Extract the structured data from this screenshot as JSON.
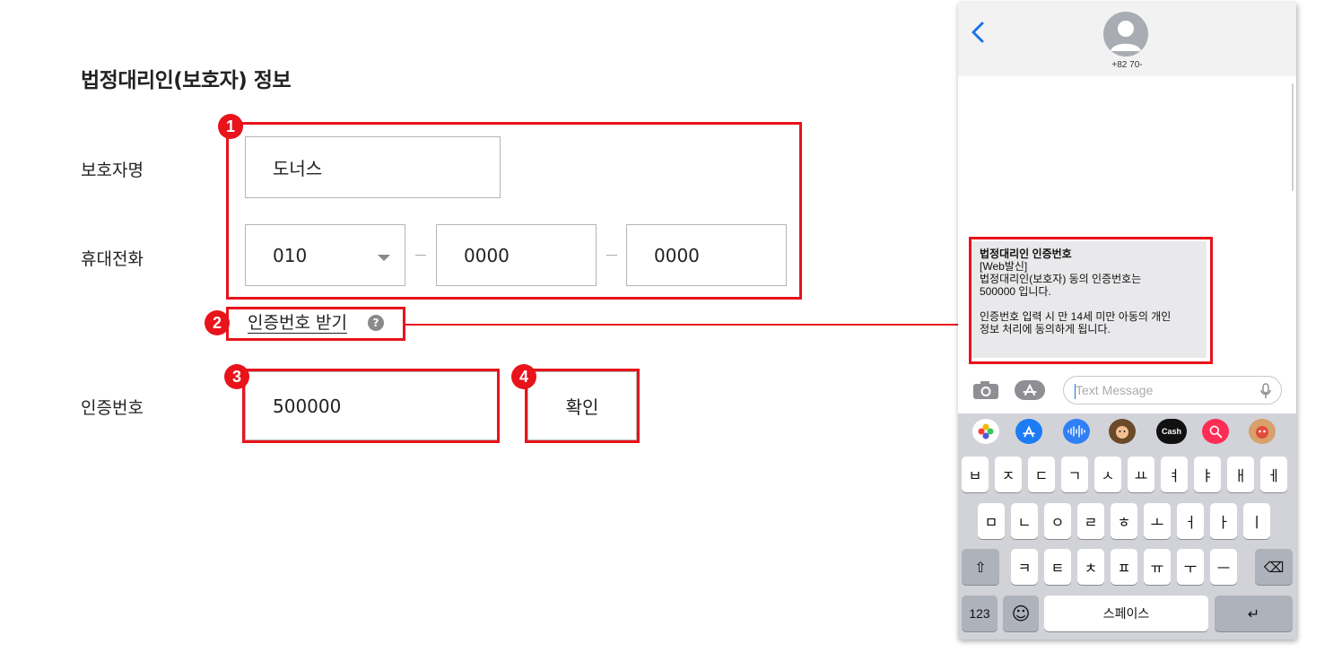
{
  "form": {
    "section_title": "법정대리인(보호자) 정보",
    "guardian_name_label": "보호자명",
    "guardian_name_value": "도너스",
    "phone_label": "휴대전화",
    "phone_prefix_value": "010",
    "phone_middle_value": "0000",
    "phone_last_value": "0000",
    "get_code_link": "인증번호 받기",
    "help_icon_text": "?",
    "code_label": "인증번호",
    "code_value": "500000",
    "confirm_button": "확인"
  },
  "badges": [
    "1",
    "2",
    "3",
    "4"
  ],
  "annotation_color": "#e8131b",
  "phone": {
    "contact_number": "+82 70-",
    "sms_lines": [
      "법정대리인 인증번호",
      "[Web발신]",
      "법정대리인(보호자) 동의 인증번호는",
      "500000 입니다.",
      "",
      "인증번호 입력 시 만 14세 미만 아동의 개인",
      "정보 처리에 동의하게 됩니다."
    ],
    "message_placeholder": "Text Message",
    "apple_cash_label": "Cash",
    "keyboard": {
      "row1": [
        "ㅂ",
        "ㅈ",
        "ㄷ",
        "ㄱ",
        "ㅅ",
        "ㅛ",
        "ㅕ",
        "ㅑ",
        "ㅐ",
        "ㅔ"
      ],
      "row2": [
        "ㅁ",
        "ㄴ",
        "ㅇ",
        "ㄹ",
        "ㅎ",
        "ㅗ",
        "ㅓ",
        "ㅏ",
        "ㅣ"
      ],
      "row3": [
        "ㅋ",
        "ㅌ",
        "ㅊ",
        "ㅍ",
        "ㅠ",
        "ㅜ",
        "ㅡ"
      ],
      "numbers_key": "123",
      "space_key": "스페이스",
      "shift_icon": "⇧",
      "delete_icon": "⌫",
      "emoji_icon": "☺",
      "return_icon": "↵"
    }
  }
}
